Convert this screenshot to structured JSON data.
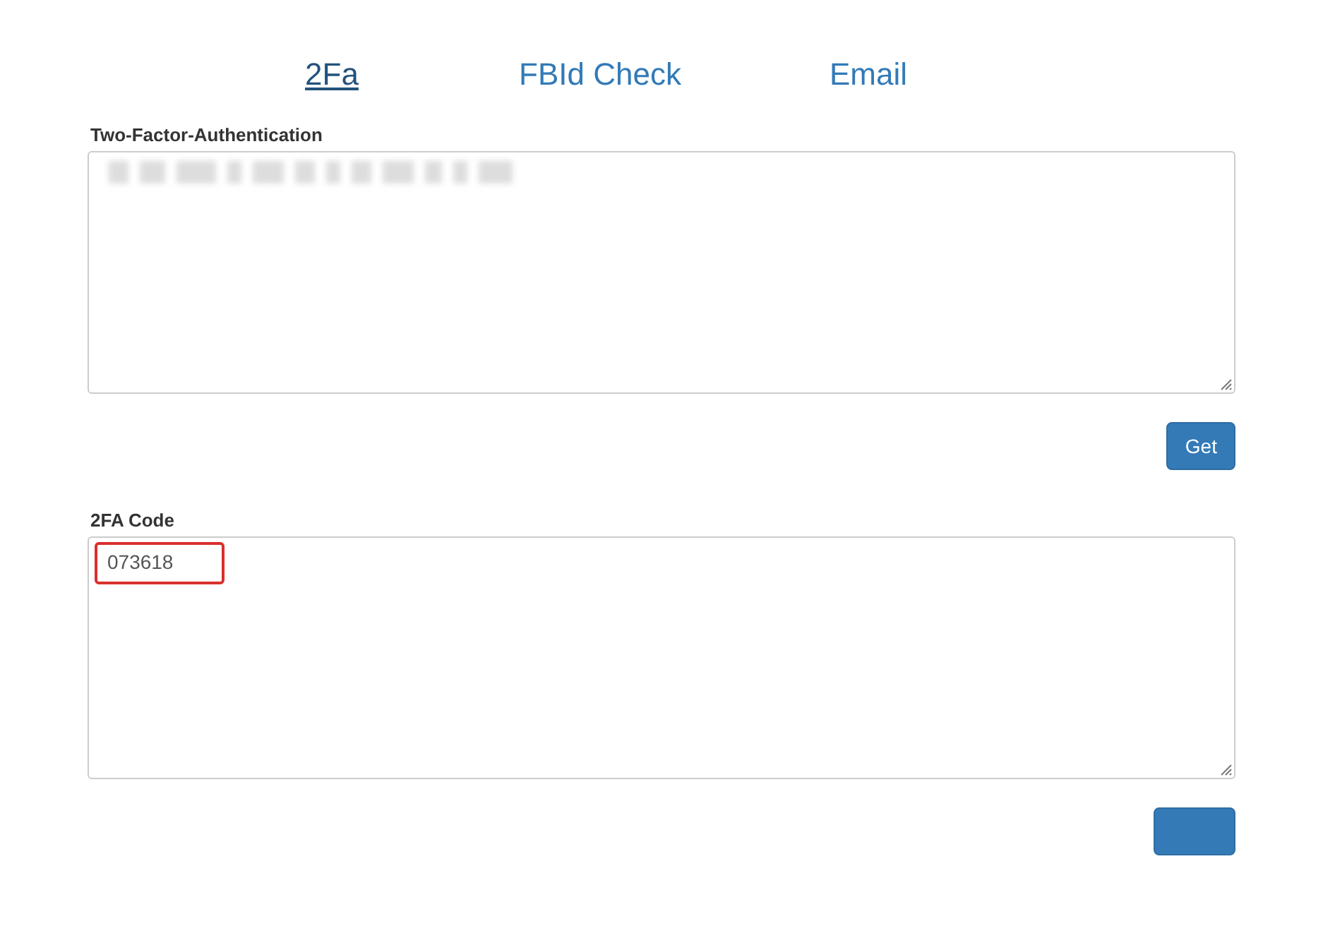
{
  "tabs": [
    {
      "label": "2Fa",
      "selected": true
    },
    {
      "label": "FBId Check",
      "selected": false
    },
    {
      "label": "Email",
      "selected": false
    }
  ],
  "secret_field": {
    "label": "Two-Factor-Authentication",
    "redacted": true
  },
  "get_button": {
    "label": "Get"
  },
  "code_field": {
    "label": "2FA Code",
    "value": "073618",
    "highlighted": true
  },
  "bottom_button": {
    "kind": "blank"
  }
}
